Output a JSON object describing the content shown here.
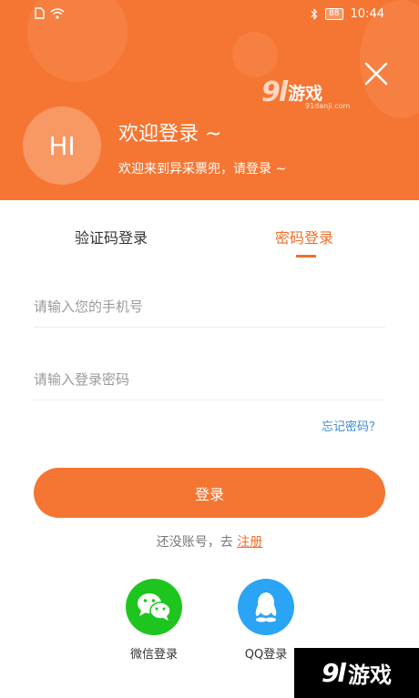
{
  "colors": {
    "accent": "#f57632",
    "link": "#3a8bd6",
    "wechat": "#1fc51f",
    "qq": "#2aa4f4"
  },
  "status_bar": {
    "time": "10:44",
    "battery": "88"
  },
  "watermark": {
    "mark": "9l",
    "name": "游戏",
    "url": "91danji.com"
  },
  "header": {
    "avatar_text": "HI",
    "title": "欢迎登录 ~",
    "subtitle": "欢迎来到异采票兜，请登录 ~"
  },
  "tabs": {
    "sms": "验证码登录",
    "password": "密码登录",
    "active": "password"
  },
  "form": {
    "phone_placeholder": "请输入您的手机号",
    "password_placeholder": "请输入登录密码",
    "forgot": "忘记密码？",
    "login_button": "登录"
  },
  "register": {
    "prompt": "还没账号，去 ",
    "link": "注册"
  },
  "social": {
    "wechat": "微信登录",
    "qq": "QQ登录"
  }
}
